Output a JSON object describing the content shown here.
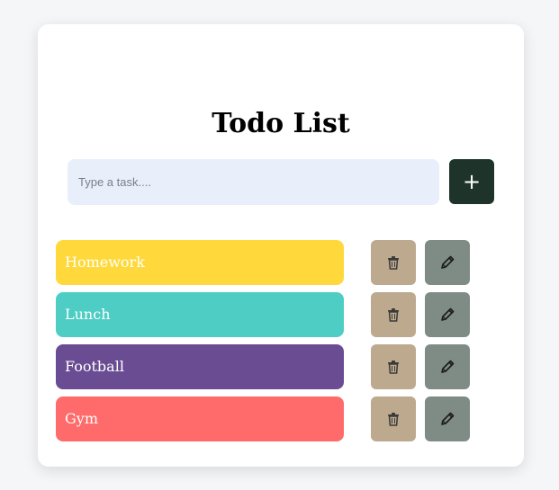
{
  "app": {
    "title": "Todo List"
  },
  "input": {
    "placeholder": "Type a task....",
    "value": ""
  },
  "add_button": {
    "label": "+"
  },
  "tasks": [
    {
      "label": "Homework",
      "color": "#ffd93b"
    },
    {
      "label": "Lunch",
      "color": "#4ecdc4"
    },
    {
      "label": "Football",
      "color": "#6a4c93"
    },
    {
      "label": "Gym",
      "color": "#ff6b6b"
    }
  ],
  "actions": {
    "delete_icon": "trash-icon",
    "edit_icon": "pencil-icon",
    "delete_color": "#bca98e",
    "edit_color": "#7e8c85"
  },
  "colors": {
    "add_button": "#1e342a",
    "input_bg": "#e8effb"
  }
}
